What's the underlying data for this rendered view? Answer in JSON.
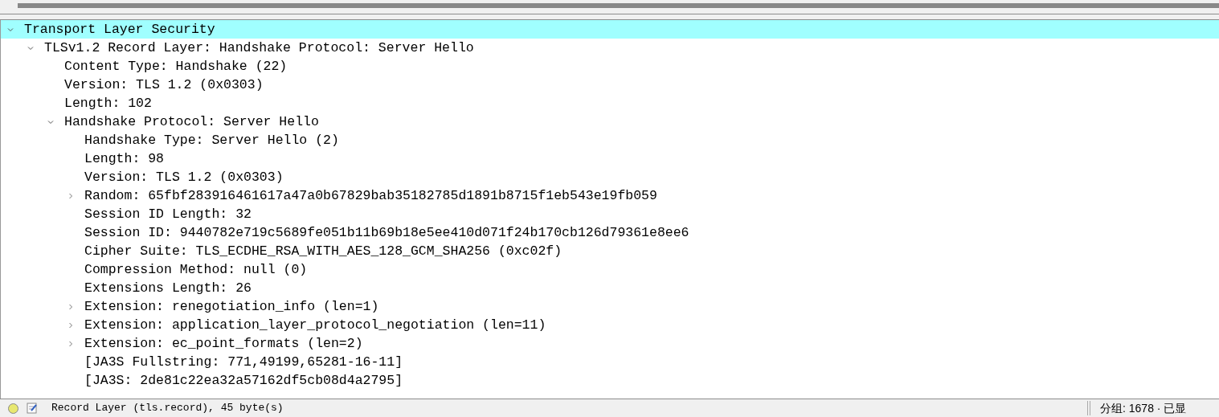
{
  "tree": [
    {
      "label": "Transport Layer Security",
      "expanded": true,
      "selected": true,
      "children": [
        {
          "label": "TLSv1.2 Record Layer: Handshake Protocol: Server Hello",
          "expanded": true,
          "selected": false,
          "children": [
            {
              "label": "Content Type: Handshake (22)",
              "selected": false
            },
            {
              "label": "Version: TLS 1.2 (0x0303)",
              "selected": false
            },
            {
              "label": "Length: 102",
              "selected": false
            },
            {
              "label": "Handshake Protocol: Server Hello",
              "expanded": true,
              "selected": false,
              "children": [
                {
                  "label": "Handshake Type: Server Hello (2)",
                  "selected": false
                },
                {
                  "label": "Length: 98",
                  "selected": false
                },
                {
                  "label": "Version: TLS 1.2 (0x0303)",
                  "selected": false
                },
                {
                  "label": "Random: 65fbf283916461617a47a0b67829bab35182785d1891b8715f1eb543e19fb059",
                  "expanded": false,
                  "selected": false
                },
                {
                  "label": "Session ID Length: 32",
                  "selected": false
                },
                {
                  "label": "Session ID: 9440782e719c5689fe051b11b69b18e5ee410d071f24b170cb126d79361e8ee6",
                  "selected": false
                },
                {
                  "label": "Cipher Suite: TLS_ECDHE_RSA_WITH_AES_128_GCM_SHA256 (0xc02f)",
                  "selected": false
                },
                {
                  "label": "Compression Method: null (0)",
                  "selected": false
                },
                {
                  "label": "Extensions Length: 26",
                  "selected": false
                },
                {
                  "label": "Extension: renegotiation_info (len=1)",
                  "expanded": false,
                  "selected": false
                },
                {
                  "label": "Extension: application_layer_protocol_negotiation (len=11)",
                  "expanded": false,
                  "selected": false
                },
                {
                  "label": "Extension: ec_point_formats (len=2)",
                  "expanded": false,
                  "selected": false
                },
                {
                  "label": "[JA3S Fullstring: 771,49199,65281-16-11]",
                  "selected": false
                },
                {
                  "label": "[JA3S: 2de81c22ea32a57162df5cb08d4a2795]",
                  "selected": false
                }
              ]
            }
          ]
        }
      ]
    }
  ],
  "status_bar": {
    "field_info": "Record Layer (tls.record), 45 byte(s)",
    "packets": "分组: 1678 · 已显"
  }
}
